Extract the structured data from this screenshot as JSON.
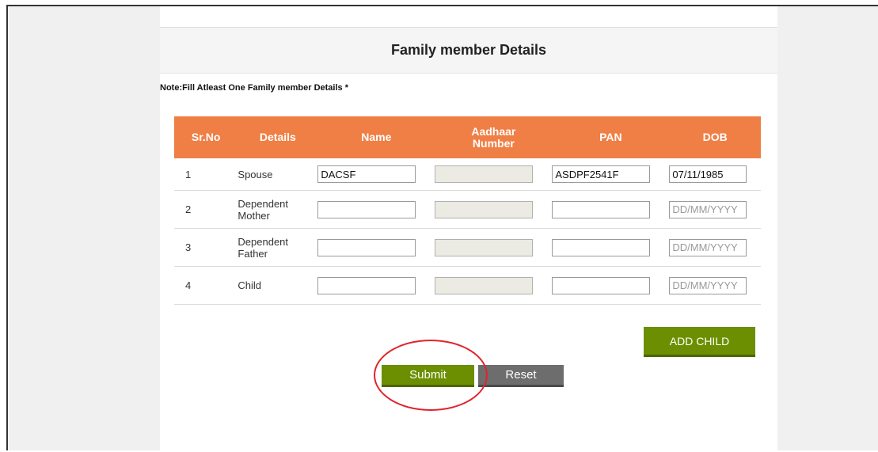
{
  "form": {
    "title": "Family member Details",
    "note": "Note:Fill Atleast One Family member Details *"
  },
  "table": {
    "headers": {
      "sr": "Sr.No",
      "details": "Details",
      "name": "Name",
      "aadhaar_line1": "Aadhaar",
      "aadhaar_line2": "Number",
      "pan": "PAN",
      "dob": "DOB"
    },
    "rows": [
      {
        "sr": "1",
        "details": "Spouse",
        "name": "DACSF",
        "aadhaar": "",
        "pan": "ASDPF2541F",
        "dob": "07/11/1985"
      },
      {
        "sr": "2",
        "details": "Dependent Mother",
        "name": "",
        "aadhaar": "",
        "pan": "",
        "dob": ""
      },
      {
        "sr": "3",
        "details": "Dependent Father",
        "name": "",
        "aadhaar": "",
        "pan": "",
        "dob": ""
      },
      {
        "sr": "4",
        "details": "Child",
        "name": "",
        "aadhaar": "",
        "pan": "",
        "dob": ""
      }
    ],
    "dob_placeholder": "DD/MM/YYYY"
  },
  "actions": {
    "add_child": "ADD CHILD",
    "submit": "Submit",
    "reset": "Reset"
  },
  "colors": {
    "header_bg": "#ef7f45",
    "green_button": "#6b8f00",
    "grey_button": "#6d6d6d",
    "highlight_circle": "#e0242c"
  }
}
